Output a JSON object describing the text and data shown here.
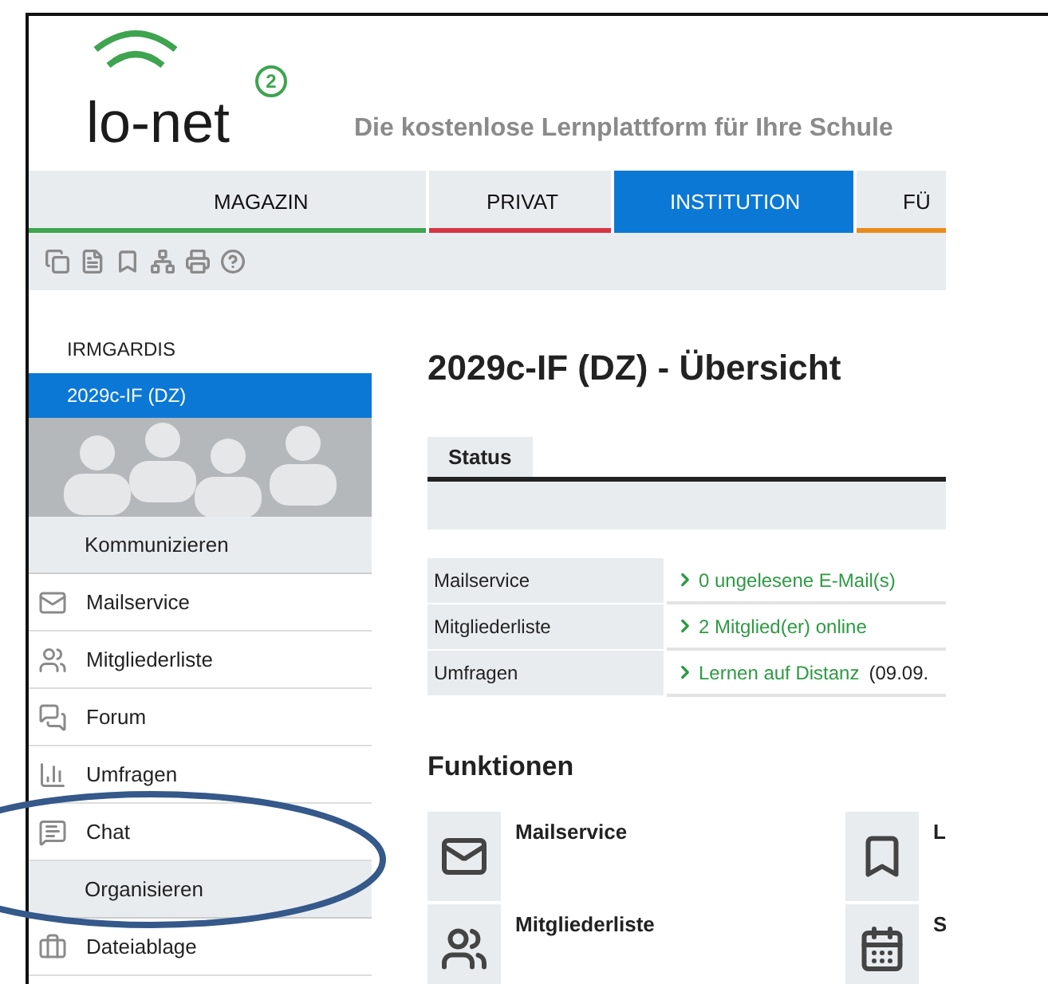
{
  "header": {
    "logo": "lo-net",
    "logo_badge": "2",
    "tagline": "Die kostenlose Lernplattform für Ihre Schule"
  },
  "tabs": [
    {
      "label": "MAGAZIN",
      "color": "#3ea44f",
      "selected": false
    },
    {
      "label": "PRIVAT",
      "color": "#d63545",
      "selected": false
    },
    {
      "label": "INSTITUTION",
      "color": "#0b78d6",
      "selected": true
    },
    {
      "label": "FÜ",
      "color": "#e98a1c",
      "selected": false
    }
  ],
  "sidebar": {
    "institution": "IRMGARDIS",
    "group": {
      "label": "2029c-IF (DZ)",
      "selected": true
    },
    "sections": [
      {
        "heading": "Kommunizieren",
        "items": [
          {
            "label": "Mailservice",
            "selected": false
          },
          {
            "label": "Mitgliederliste",
            "selected": false
          },
          {
            "label": "Forum",
            "selected": false
          },
          {
            "label": "Umfragen",
            "selected": false
          },
          {
            "label": "Chat",
            "selected": false
          }
        ]
      },
      {
        "heading": "Organisieren",
        "items": [
          {
            "label": "Dateiablage",
            "selected": false
          }
        ]
      }
    ]
  },
  "main": {
    "title": "2029c-IF (DZ) - Übersicht",
    "status_tab": "Status",
    "status_rows": [
      {
        "label": "Mailservice",
        "link": "0 ungelesene E-Mail(s)"
      },
      {
        "label": "Mitgliederliste",
        "link": "2 Mitglied(er) online"
      },
      {
        "label": "Umfragen",
        "link": "Lernen auf Distanz",
        "suffix": "(09.09."
      }
    ],
    "functions_heading": "Funktionen",
    "functions": [
      {
        "title": "Mailservice"
      },
      {
        "title": "L"
      },
      {
        "title": "Mitgliederliste"
      },
      {
        "title": "S"
      }
    ]
  }
}
